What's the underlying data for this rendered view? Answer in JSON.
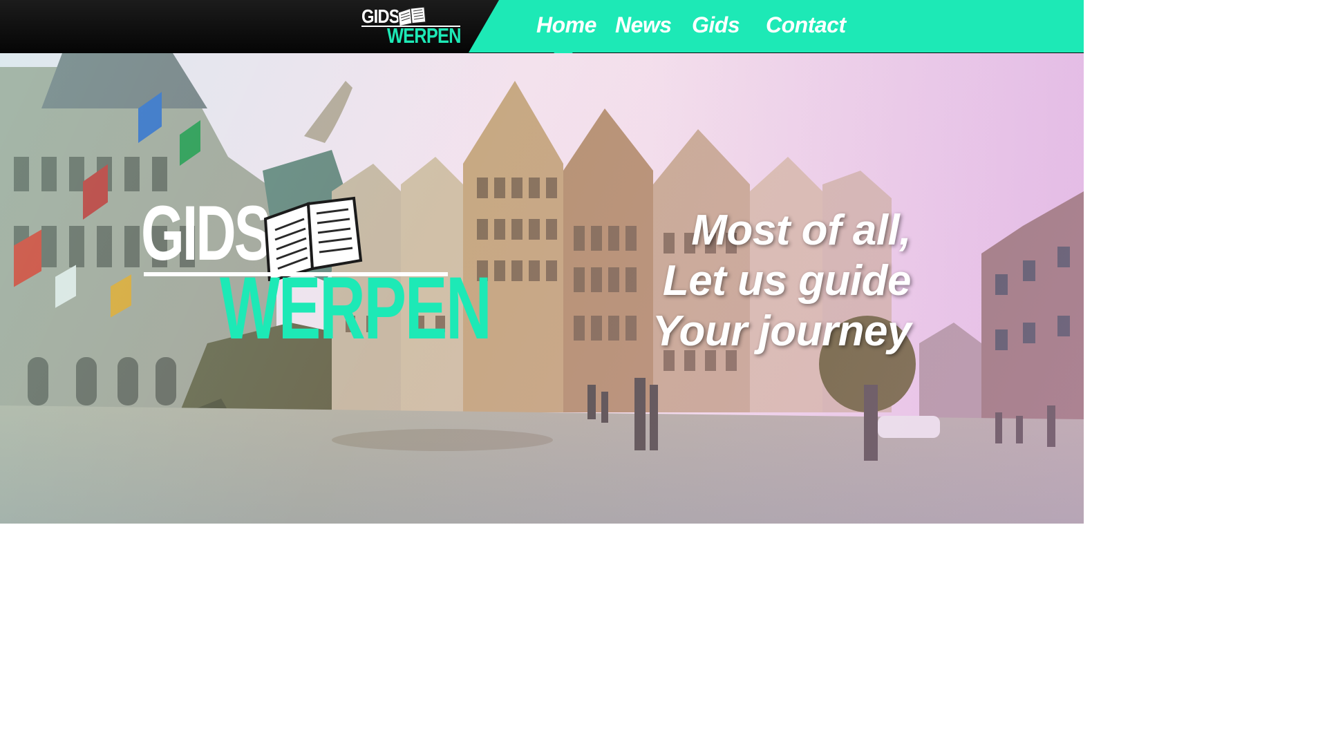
{
  "brand": {
    "line1": "GIDS",
    "line2": "WERPEN",
    "icon": "open-book-icon",
    "accent_color": "#1de9b6"
  },
  "nav": {
    "items": [
      {
        "label": "Home",
        "active": true
      },
      {
        "label": "News"
      },
      {
        "label": "Gids"
      },
      {
        "label": "Contact"
      }
    ]
  },
  "hero": {
    "tagline": [
      "Most of all,",
      "Let us guide",
      "Your journey"
    ]
  }
}
